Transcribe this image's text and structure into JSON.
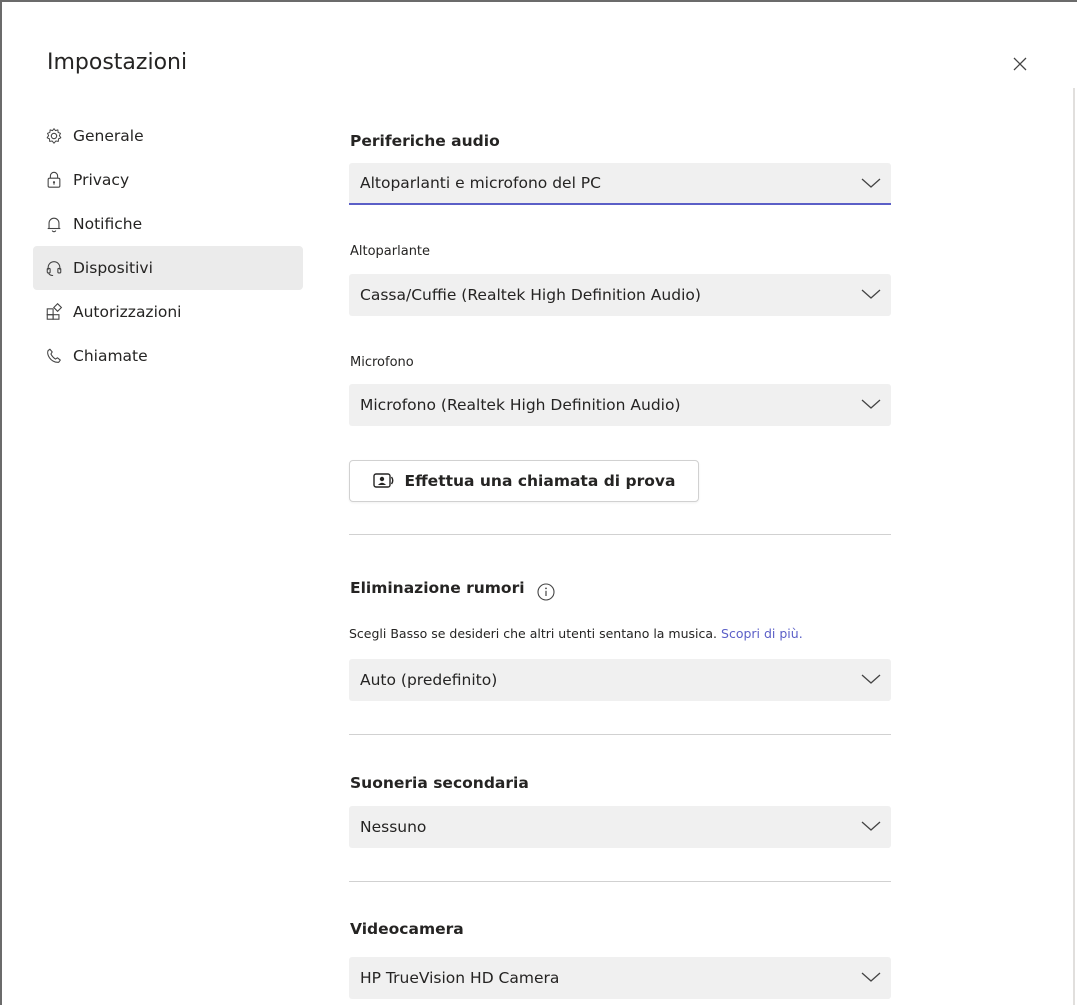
{
  "dialog": {
    "title": "Impostazioni"
  },
  "nav": {
    "items": [
      {
        "label": "Generale",
        "icon": "gear-icon"
      },
      {
        "label": "Privacy",
        "icon": "lock-icon"
      },
      {
        "label": "Notifiche",
        "icon": "bell-icon"
      },
      {
        "label": "Dispositivi",
        "icon": "headset-icon",
        "active": true
      },
      {
        "label": "Autorizzazioni",
        "icon": "apps-icon"
      },
      {
        "label": "Chiamate",
        "icon": "phone-icon"
      }
    ]
  },
  "audio": {
    "heading": "Periferiche audio",
    "device": "Altoparlanti e microfono del PC",
    "speaker_label": "Altoparlante",
    "speaker": "Cassa/Cuffie (Realtek High Definition Audio)",
    "mic_label": "Microfono",
    "mic": "Microfono (Realtek High Definition Audio)",
    "test_call_label": "Effettua una chiamata di prova"
  },
  "noise": {
    "heading": "Eliminazione rumori",
    "description": "Scegli Basso se desideri che altri utenti sentano la musica.",
    "learn_more": "Scopri di più.",
    "value": "Auto (predefinito)"
  },
  "ringer": {
    "heading": "Suoneria secondaria",
    "value": "Nessuno"
  },
  "camera": {
    "heading": "Videocamera",
    "value": "HP TrueVision HD Camera"
  },
  "colors": {
    "accent": "#5b5fc7",
    "active_nav_bg": "#ebebeb",
    "select_bg": "#f0f0f0"
  }
}
